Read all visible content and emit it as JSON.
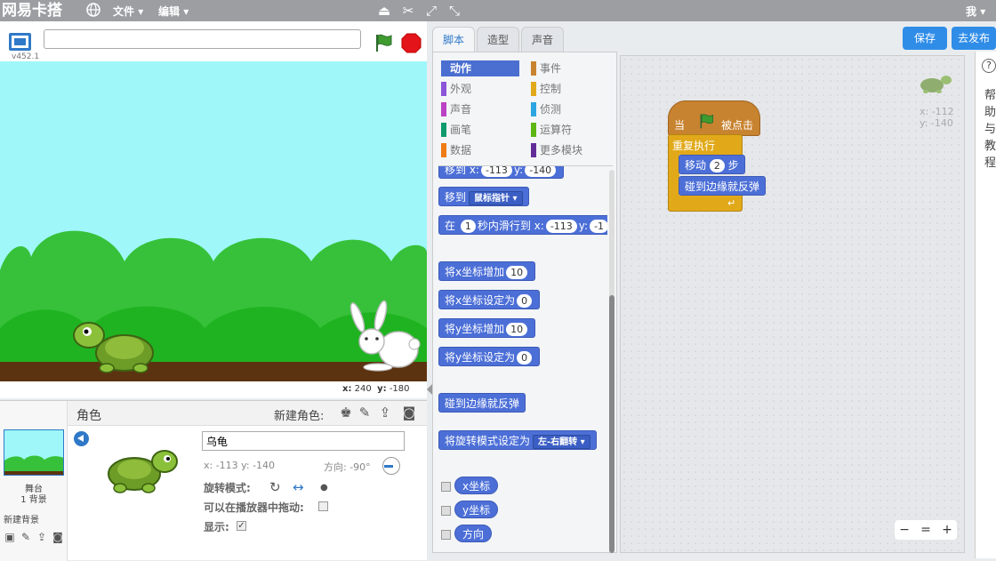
{
  "app": {
    "logo": "网易卡搭",
    "menus": [
      "文件",
      "编辑"
    ],
    "user": "我"
  },
  "stage_bar": {
    "version": "v452.1",
    "project_title_value": "",
    "coords_x_label": "x:",
    "coords_x": "240",
    "coords_y_label": "y:",
    "coords_y": "-180"
  },
  "sprite_pane": {
    "title": "角色",
    "new_sprite": "新建角色:",
    "stage_label": "舞台",
    "stage_bg_count": "1 背景",
    "new_bg": "新建背景",
    "sprite_name": "乌龟",
    "sprite_xy": "x: -113  y: -140",
    "direction": "方向: -90°",
    "rotation_mode": "旋转模式:",
    "draggable": "可以在播放器中拖动:",
    "show": "显示:",
    "show_check": "✓"
  },
  "tabs": [
    "脚本",
    "造型",
    "声音"
  ],
  "actions": {
    "save": "保存",
    "share": "去发布"
  },
  "categories": {
    "left": [
      {
        "label": "动作",
        "color": "#4a6fd0"
      },
      {
        "label": "外观",
        "color": "#8a55d7"
      },
      {
        "label": "声音",
        "color": "#bb42c3"
      },
      {
        "label": "画笔",
        "color": "#0e9a6c"
      },
      {
        "label": "数据",
        "color": "#ee7d16"
      }
    ],
    "right": [
      {
        "label": "事件",
        "color": "#c88330"
      },
      {
        "label": "控制",
        "color": "#e1a91a"
      },
      {
        "label": "侦测",
        "color": "#2ca5e2"
      },
      {
        "label": "运算符",
        "color": "#5cb712"
      },
      {
        "label": "更多模块",
        "color": "#632d99"
      }
    ]
  },
  "palette_blocks": {
    "goto_xy": {
      "prefix": "移到 x:",
      "x": "-113",
      "ylab": "y:",
      "y": "-140"
    },
    "goto": {
      "label": "移到",
      "dd": "鼠标指针"
    },
    "glide": {
      "a": "在",
      "secs": "1",
      "b": "秒内滑行到 x:",
      "x": "-113",
      "ylab": "y:",
      "y": "-1"
    },
    "change_x": {
      "label": "将x坐标增加",
      "v": "10"
    },
    "set_x": {
      "label": "将x坐标设定为",
      "v": "0"
    },
    "change_y": {
      "label": "将y坐标增加",
      "v": "10"
    },
    "set_y": {
      "label": "将y坐标设定为",
      "v": "0"
    },
    "bounce": "碰到边缘就反弹",
    "rot_style": {
      "label": "将旋转模式设定为",
      "dd": "左-右翻转"
    },
    "reporters": [
      "x坐标",
      "y坐标",
      "方向"
    ]
  },
  "script": {
    "hat_when": "当",
    "hat_clicked": "被点击",
    "forever": "重复执行",
    "move_a": "移动",
    "move_steps": "2",
    "move_b": "步",
    "bounce": "碰到边缘就反弹",
    "ghost_x": "x: -112",
    "ghost_y": "y: -140",
    "zoom_out": "−",
    "zoom_reset": "=",
    "zoom_in": "+"
  },
  "help": {
    "q": "?",
    "text": "帮助与教程"
  }
}
